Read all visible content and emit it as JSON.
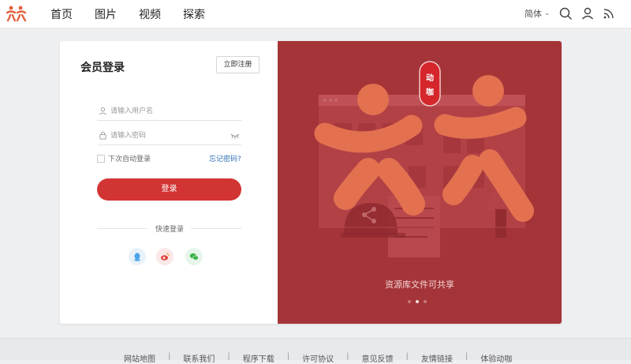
{
  "nav": {
    "items": [
      "首页",
      "图片",
      "视频",
      "探索"
    ]
  },
  "header": {
    "lang": "简体"
  },
  "login": {
    "title": "会员登录",
    "register": "立即注册",
    "username_placeholder": "请输入用户名",
    "password_placeholder": "请输入密码",
    "remember": "下次自动登录",
    "forgot": "忘记密码?",
    "submit": "登录",
    "quick": "快速登录"
  },
  "promo": {
    "stamp": [
      "动",
      "咖"
    ],
    "caption": "资源库文件可共享",
    "slides": 3,
    "active_slide": 2
  },
  "footer": {
    "links": [
      "网站地图",
      "联系我们",
      "程序下载",
      "许可协议",
      "意见反馈",
      "友情链接",
      "体验动咖"
    ]
  },
  "colors": {
    "brand": "#d23433",
    "promo_bg": "#a53438",
    "link": "#2d6fb5"
  },
  "icons": [
    "logo-icon",
    "search-icon",
    "user-icon",
    "rss-icon",
    "user-field-icon",
    "lock-icon",
    "eye-closed-icon",
    "qq-icon",
    "weibo-icon",
    "wechat-icon",
    "share-icon"
  ]
}
